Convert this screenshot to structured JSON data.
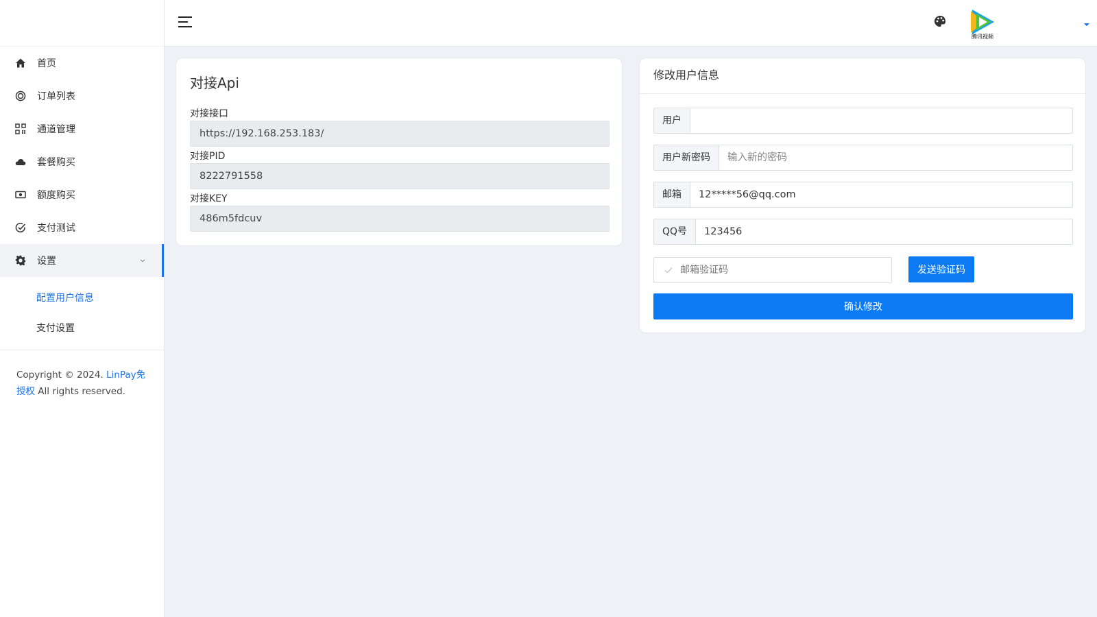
{
  "sidebar": {
    "items": [
      {
        "label": "首页",
        "icon": "home-icon"
      },
      {
        "label": "订单列表",
        "icon": "target-icon"
      },
      {
        "label": "通道管理",
        "icon": "qrcode-icon"
      },
      {
        "label": "套餐购买",
        "icon": "cloud-icon"
      },
      {
        "label": "额度购买",
        "icon": "money-icon"
      },
      {
        "label": "支付测试",
        "icon": "check-circle-icon"
      },
      {
        "label": "设置",
        "icon": "gear-icon"
      }
    ],
    "submenu": [
      {
        "label": "配置用户信息"
      },
      {
        "label": "支付设置"
      }
    ],
    "copyright_prefix": "Copyright © 2024.",
    "copyright_link": "LinPay免授权",
    "copyright_suffix": "All rights reserved."
  },
  "header": {
    "avatar_text": "腾讯视频",
    "accent_color": "#1a73e8"
  },
  "api_card": {
    "title": "对接Api",
    "fields": [
      {
        "label": "对接接口",
        "value": "https://192.168.253.183/"
      },
      {
        "label": "对接PID",
        "value": "8222791558"
      },
      {
        "label": "对接KEY",
        "value": "486m5fdcuv"
      }
    ]
  },
  "user_card": {
    "title": "修改用户信息",
    "user_label": "用户",
    "user_value": "",
    "password_label": "用户新密码",
    "password_placeholder": "输入新的密码",
    "email_label": "邮箱",
    "email_value": "12*****56@qq.com",
    "qq_label": "QQ号",
    "qq_value": "123456",
    "code_placeholder": "邮箱验证码",
    "send_button": "发送验证码",
    "confirm_button": "确认修改"
  }
}
